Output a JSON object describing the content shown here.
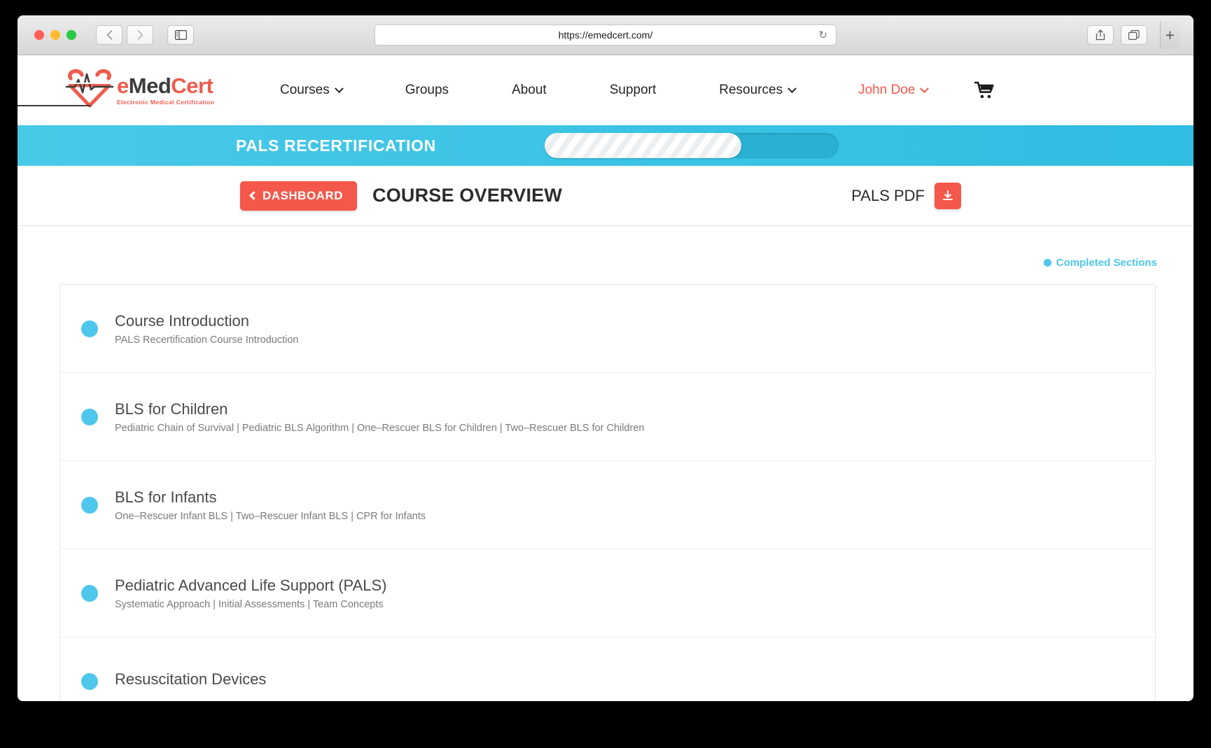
{
  "browser": {
    "url": "https://emedcert.com/",
    "back_icon": "chevron-left-icon",
    "forward_icon": "chevron-right-icon",
    "sidebar_icon": "sidebar-toggle-icon",
    "reload_icon": "reload-icon",
    "share_icon": "share-icon",
    "tabs_icon": "show-tabs-icon",
    "new_tab_label": "+"
  },
  "site": {
    "logo": {
      "name_part1": "e",
      "name_part2": "Med",
      "name_part3": "Cert",
      "tagline": "Electronic Medical Certification"
    },
    "nav": [
      {
        "label": "Courses",
        "has_chevron": true
      },
      {
        "label": "Groups",
        "has_chevron": false
      },
      {
        "label": "About",
        "has_chevron": false
      },
      {
        "label": "Support",
        "has_chevron": false
      },
      {
        "label": "Resources",
        "has_chevron": true
      }
    ],
    "user": {
      "label": "John Doe",
      "has_chevron": true
    },
    "cart_icon": "shopping-cart-icon"
  },
  "banner": {
    "title": "PALS RECERTIFICATION",
    "progress_percent": 67,
    "track_color": "#2ab0d2",
    "banner_color": "#2fbde2"
  },
  "subheader": {
    "dashboard_label": "DASHBOARD",
    "back_icon": "chevron-left-icon",
    "page_title": "COURSE OVERVIEW",
    "pdf_label": "PALS PDF",
    "download_icon": "download-icon",
    "accent_color": "#f4584a"
  },
  "legend": {
    "label": "Completed Sections",
    "color": "#4fc7ec"
  },
  "sections": [
    {
      "title": "Course Introduction",
      "subtitle": "PALS Recertification Course Introduction",
      "completed": true
    },
    {
      "title": "BLS for Children",
      "subtitle": "Pediatric Chain of Survival | Pediatric BLS Algorithm | One–Rescuer BLS for Children | Two–Rescuer BLS for Children",
      "completed": true
    },
    {
      "title": "BLS for Infants",
      "subtitle": "One–Rescuer Infant BLS | Two–Rescuer Infant BLS | CPR for Infants",
      "completed": true
    },
    {
      "title": "Pediatric Advanced Life Support (PALS)",
      "subtitle": "Systematic Approach | Initial Assessments | Team Concepts",
      "completed": true
    },
    {
      "title": "Resuscitation Devices",
      "subtitle": "",
      "completed": true
    }
  ]
}
